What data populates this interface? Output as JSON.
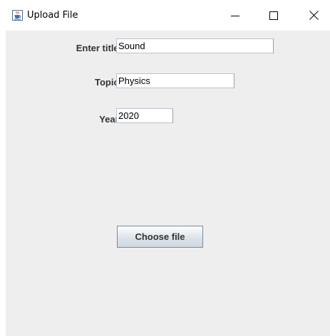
{
  "window": {
    "title": "Upload File",
    "controls": {
      "minimize": "minimize-icon",
      "maximize": "maximize-icon",
      "close": "close-icon"
    },
    "app_icon": "java-cup-icon"
  },
  "form": {
    "title_label": "Enter title:",
    "title_value": "Sound",
    "topic_label": "Topic:",
    "topic_value": "Physics",
    "year_label": "Year:",
    "year_value": "2020"
  },
  "actions": {
    "choose_file_label": "Choose file"
  },
  "colors": {
    "panel_background": "#eeeeee",
    "label_text": "#333333",
    "field_border": "#b9c3cd",
    "button_border": "#7a8a99"
  }
}
